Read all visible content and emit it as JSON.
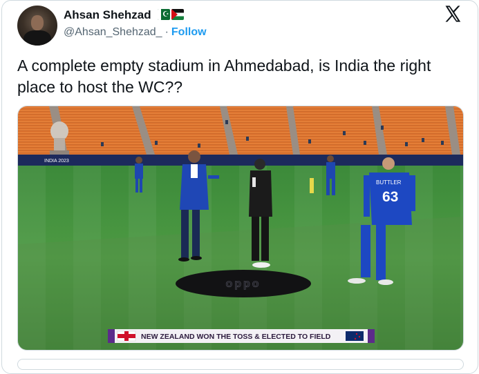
{
  "author": {
    "name": "Ahsan Shehzad",
    "handle": "@Ahsan_Shehzad_",
    "separator": "·",
    "follow_label": "Follow",
    "flags": [
      "pakistan-flag",
      "palestine-flag"
    ]
  },
  "tweet": {
    "text": "A complete empty stadium in Ahmedabad, is India the right place to host the WC??"
  },
  "media": {
    "type": "photo",
    "description_icon": "cricket-toss-photo",
    "event_badge": "INDIA 2023",
    "player_jersey_name": "BUTTLER",
    "player_jersey_number": "63",
    "mat_logo": "oppo",
    "caption": "NEW ZEALAND WON THE TOSS & ELECTED TO FIELD"
  },
  "colors": {
    "follow": "#1d9bf0",
    "text": "#0f1419",
    "muted": "#536471",
    "seats": "#e8823a",
    "pitch": "#3f8a3c"
  }
}
